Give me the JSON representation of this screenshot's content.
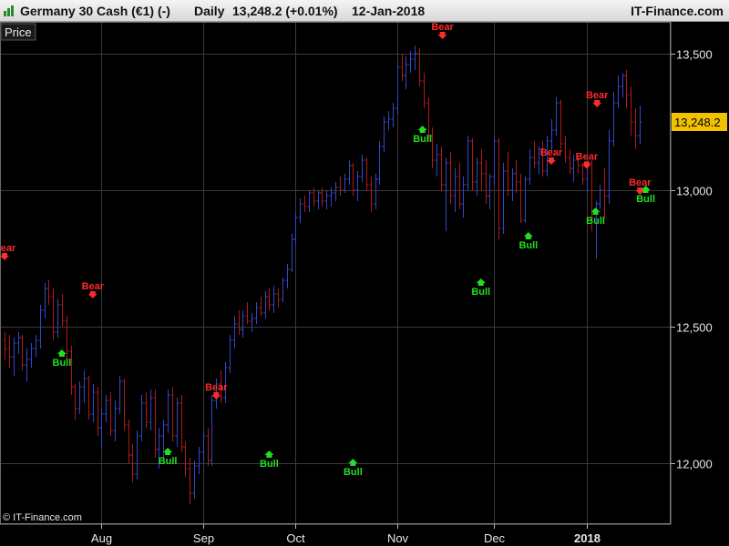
{
  "header": {
    "instrument": "Germany 30 Cash (€1) (-)",
    "period": "Daily",
    "price_change": "13,248.2 (+0.01%)",
    "date": "12-Jan-2018",
    "brand": "IT-Finance.com"
  },
  "panel_label": "Price",
  "copyright": "© IT-Finance.com",
  "last_price_label": "13,248.2",
  "colors": {
    "background": "#000000",
    "grid": "#3a3a3a",
    "up_bar": "#3048c8",
    "down_bar": "#b01818",
    "bull_signal": "#22dd22",
    "bear_signal": "#ff2a2a",
    "last_price_badge": "#f2c200"
  },
  "chart_data": {
    "type": "ohlc",
    "title": "Germany 30 Cash (€1) (-)",
    "ylim": [
      11850,
      13650
    ],
    "yticks": [
      {
        "value": 12000,
        "label": "12,000"
      },
      {
        "value": 12500,
        "label": "12,500"
      },
      {
        "value": 13000,
        "label": "13,000"
      },
      {
        "value": 13500,
        "label": "13,500"
      }
    ],
    "xticks": [
      {
        "index": 22,
        "label": "Aug"
      },
      {
        "index": 45,
        "label": "Sep"
      },
      {
        "index": 66,
        "label": "Oct"
      },
      {
        "index": 89,
        "label": "Nov"
      },
      {
        "index": 111,
        "label": "Dec"
      },
      {
        "index": 132,
        "label": "2018",
        "bold": true
      }
    ],
    "n_slots": 146,
    "bars": [
      [
        0,
        12450,
        12480,
        12380,
        12420
      ],
      [
        1,
        12420,
        12470,
        12350,
        12390
      ],
      [
        2,
        12390,
        12460,
        12320,
        12440
      ],
      [
        3,
        12440,
        12480,
        12400,
        12460
      ],
      [
        4,
        12460,
        12470,
        12340,
        12360
      ],
      [
        5,
        12360,
        12420,
        12300,
        12380
      ],
      [
        6,
        12380,
        12440,
        12350,
        12420
      ],
      [
        7,
        12420,
        12470,
        12390,
        12450
      ],
      [
        8,
        12450,
        12580,
        12420,
        12560
      ],
      [
        9,
        12560,
        12660,
        12530,
        12640
      ],
      [
        10,
        12640,
        12670,
        12580,
        12610
      ],
      [
        11,
        12610,
        12640,
        12450,
        12480
      ],
      [
        12,
        12480,
        12600,
        12460,
        12580
      ],
      [
        13,
        12580,
        12620,
        12500,
        12520
      ],
      [
        14,
        12520,
        12540,
        12380,
        12410
      ],
      [
        15,
        12410,
        12430,
        12250,
        12280
      ],
      [
        16,
        12280,
        12290,
        12160,
        12200
      ],
      [
        17,
        12200,
        12300,
        12180,
        12280
      ],
      [
        18,
        12280,
        12340,
        12220,
        12310
      ],
      [
        19,
        12310,
        12320,
        12160,
        12180
      ],
      [
        20,
        12180,
        12290,
        12150,
        12260
      ],
      [
        21,
        12260,
        12280,
        12100,
        12130
      ],
      [
        22,
        12130,
        12200,
        12050,
        12180
      ],
      [
        23,
        12180,
        12250,
        12150,
        12230
      ],
      [
        24,
        12230,
        12260,
        12100,
        12120
      ],
      [
        25,
        12120,
        12230,
        12080,
        12200
      ],
      [
        26,
        12200,
        12320,
        12180,
        12300
      ],
      [
        27,
        12300,
        12310,
        12120,
        12140
      ],
      [
        28,
        12140,
        12160,
        12000,
        12030
      ],
      [
        29,
        12030,
        12070,
        11930,
        11960
      ],
      [
        30,
        11960,
        12120,
        11940,
        12100
      ],
      [
        31,
        12100,
        12250,
        12080,
        12220
      ],
      [
        32,
        12220,
        12260,
        12130,
        12150
      ],
      [
        33,
        12150,
        12270,
        12120,
        12240
      ],
      [
        34,
        12240,
        12270,
        12020,
        12050
      ],
      [
        35,
        12050,
        12130,
        11980,
        12100
      ],
      [
        36,
        12100,
        12160,
        12020,
        12140
      ],
      [
        37,
        12140,
        12270,
        12110,
        12250
      ],
      [
        38,
        12250,
        12280,
        12080,
        12100
      ],
      [
        39,
        12100,
        12240,
        12060,
        12220
      ],
      [
        40,
        12220,
        12250,
        12040,
        12060
      ],
      [
        41,
        12060,
        12080,
        11950,
        11980
      ],
      [
        42,
        11980,
        12020,
        11850,
        11890
      ],
      [
        43,
        11890,
        12010,
        11870,
        11990
      ],
      [
        44,
        11990,
        12060,
        11960,
        12040
      ],
      [
        45,
        12040,
        12120,
        12000,
        12100
      ],
      [
        46,
        12100,
        12130,
        11990,
        12010
      ],
      [
        47,
        12010,
        12250,
        11990,
        12230
      ],
      [
        48,
        12230,
        12310,
        12200,
        12290
      ],
      [
        49,
        12290,
        12340,
        12220,
        12240
      ],
      [
        50,
        12240,
        12370,
        12220,
        12350
      ],
      [
        51,
        12350,
        12470,
        12330,
        12450
      ],
      [
        52,
        12450,
        12540,
        12420,
        12510
      ],
      [
        53,
        12510,
        12560,
        12470,
        12490
      ],
      [
        54,
        12490,
        12560,
        12460,
        12540
      ],
      [
        55,
        12540,
        12590,
        12510,
        12520
      ],
      [
        56,
        12520,
        12550,
        12480,
        12530
      ],
      [
        57,
        12530,
        12590,
        12510,
        12570
      ],
      [
        58,
        12570,
        12610,
        12540,
        12550
      ],
      [
        59,
        12550,
        12630,
        12530,
        12610
      ],
      [
        60,
        12610,
        12640,
        12560,
        12580
      ],
      [
        61,
        12580,
        12650,
        12550,
        12620
      ],
      [
        62,
        12620,
        12640,
        12570,
        12600
      ],
      [
        63,
        12600,
        12680,
        12590,
        12670
      ],
      [
        64,
        12670,
        12730,
        12640,
        12710
      ],
      [
        65,
        12710,
        12840,
        12700,
        12820
      ],
      [
        66,
        12820,
        12920,
        12800,
        12900
      ],
      [
        67,
        12900,
        12970,
        12880,
        12950
      ],
      [
        68,
        12950,
        12980,
        12920,
        12940
      ],
      [
        69,
        12940,
        13000,
        12920,
        12990
      ],
      [
        70,
        12990,
        13010,
        12940,
        12960
      ],
      [
        71,
        12960,
        13000,
        12930,
        12990
      ],
      [
        72,
        12990,
        13010,
        12940,
        12960
      ],
      [
        73,
        12960,
        13000,
        12930,
        12980
      ],
      [
        74,
        12980,
        13010,
        12940,
        12990
      ],
      [
        75,
        12990,
        13030,
        12960,
        13010
      ],
      [
        76,
        13010,
        13050,
        12980,
        13000
      ],
      [
        77,
        13000,
        13060,
        12990,
        13040
      ],
      [
        78,
        13040,
        13110,
        13020,
        13090
      ],
      [
        79,
        13090,
        13100,
        12980,
        13000
      ],
      [
        80,
        13000,
        13070,
        12960,
        13050
      ],
      [
        81,
        13050,
        13130,
        13030,
        13110
      ],
      [
        82,
        13110,
        13120,
        13000,
        13020
      ],
      [
        83,
        13020,
        13050,
        12920,
        12950
      ],
      [
        84,
        12950,
        13060,
        12930,
        13040
      ],
      [
        85,
        13040,
        13180,
        13020,
        13160
      ],
      [
        86,
        13160,
        13270,
        13140,
        13250
      ],
      [
        87,
        13250,
        13290,
        13220,
        13260
      ],
      [
        88,
        13260,
        13320,
        13230,
        13300
      ],
      [
        89,
        13300,
        13470,
        13280,
        13450
      ],
      [
        90,
        13450,
        13500,
        13400,
        13420
      ],
      [
        91,
        13420,
        13490,
        13370,
        13460
      ],
      [
        92,
        13460,
        13510,
        13430,
        13480
      ],
      [
        93,
        13480,
        13530,
        13440,
        13500
      ],
      [
        94,
        13500,
        13520,
        13380,
        13400
      ],
      [
        95,
        13400,
        13430,
        13300,
        13320
      ],
      [
        96,
        13320,
        13340,
        13180,
        13200
      ],
      [
        97,
        13200,
        13230,
        13080,
        13110
      ],
      [
        98,
        13110,
        13170,
        13050,
        13130
      ],
      [
        99,
        13130,
        13160,
        13000,
        13020
      ],
      [
        100,
        13020,
        13120,
        12850,
        13100
      ],
      [
        101,
        13100,
        13140,
        12950,
        12980
      ],
      [
        102,
        12980,
        13080,
        12920,
        13050
      ],
      [
        103,
        13050,
        13100,
        12930,
        12950
      ],
      [
        104,
        12950,
        13050,
        12900,
        13020
      ],
      [
        105,
        13020,
        13200,
        13000,
        13180
      ],
      [
        106,
        13180,
        13190,
        13000,
        13030
      ],
      [
        107,
        13030,
        13120,
        12980,
        13100
      ],
      [
        108,
        13100,
        13150,
        13000,
        13060
      ],
      [
        109,
        13060,
        13110,
        12950,
        12980
      ],
      [
        110,
        12980,
        13060,
        12930,
        13050
      ],
      [
        111,
        13050,
        13200,
        13020,
        13180
      ],
      [
        112,
        13180,
        13190,
        12820,
        12860
      ],
      [
        113,
        12860,
        13100,
        12840,
        13070
      ],
      [
        114,
        13070,
        13140,
        12980,
        13000
      ],
      [
        115,
        13000,
        13080,
        12960,
        13060
      ],
      [
        116,
        13060,
        13110,
        12990,
        13030
      ],
      [
        117,
        13030,
        13060,
        12880,
        12890
      ],
      [
        118,
        12890,
        13050,
        12880,
        13040
      ],
      [
        119,
        13040,
        13150,
        13020,
        13120
      ],
      [
        120,
        13120,
        13180,
        13080,
        13100
      ],
      [
        121,
        13100,
        13160,
        13060,
        13150
      ],
      [
        122,
        13150,
        13180,
        13050,
        13070
      ],
      [
        123,
        13070,
        13200,
        13050,
        13180
      ],
      [
        124,
        13180,
        13260,
        13140,
        13220
      ],
      [
        125,
        13220,
        13340,
        13200,
        13320
      ],
      [
        126,
        13320,
        13330,
        13150,
        13170
      ],
      [
        127,
        13170,
        13200,
        13100,
        13120
      ],
      [
        128,
        13120,
        13150,
        13060,
        13080
      ],
      [
        129,
        13080,
        13130,
        13030,
        13110
      ],
      [
        130,
        13110,
        13120,
        13060,
        13090
      ],
      [
        131,
        13090,
        13100,
        13020,
        13040
      ],
      [
        132,
        13040,
        13120,
        12990,
        13100
      ],
      [
        133,
        13100,
        13110,
        12850,
        12900
      ],
      [
        134,
        12900,
        12960,
        12750,
        12950
      ],
      [
        135,
        12950,
        13020,
        12930,
        13000
      ],
      [
        136,
        13000,
        13080,
        12900,
        12980
      ],
      [
        137,
        12980,
        13220,
        12950,
        13180
      ],
      [
        138,
        13180,
        13360,
        13160,
        13320
      ],
      [
        139,
        13320,
        13420,
        13300,
        13380
      ],
      [
        140,
        13380,
        13430,
        13340,
        13420
      ],
      [
        141,
        13420,
        13440,
        13300,
        13350
      ],
      [
        142,
        13350,
        13380,
        13200,
        13250
      ],
      [
        143,
        13250,
        13300,
        13150,
        13200
      ],
      [
        144,
        13200,
        13310,
        13170,
        13250
      ]
    ],
    "signals": [
      {
        "index": 0,
        "type": "bear",
        "label": "Bear",
        "value": 12760
      },
      {
        "index": 13,
        "type": "bull",
        "label": "Bull",
        "value": 12400
      },
      {
        "index": 20,
        "type": "bear",
        "label": "Bear",
        "value": 12620
      },
      {
        "index": 37,
        "type": "bull",
        "label": "Bull",
        "value": 12040
      },
      {
        "index": 48,
        "type": "bear",
        "label": "Bear",
        "value": 12250
      },
      {
        "index": 60,
        "type": "bull",
        "label": "Bull",
        "value": 12030
      },
      {
        "index": 79,
        "type": "bull",
        "label": "Bull",
        "value": 12000
      },
      {
        "index": 108,
        "type": "bull",
        "label": "Bull",
        "value": 12660
      },
      {
        "index": 132,
        "type": "bear",
        "label": "Bear",
        "value": 13095
      },
      {
        "index": 134,
        "type": "bull",
        "label": "Bull",
        "value": 12920
      },
      {
        "index": 153,
        "type": "bear",
        "label": "Bear",
        "value": 13570
      },
      {
        "index": 146,
        "type": "bull",
        "label": "Bull",
        "value": 13220
      },
      {
        "index": 183,
        "type": "bull",
        "label": "Bull",
        "value": 12830
      },
      {
        "index": 191,
        "type": "bear",
        "label": "Bear",
        "value": 13110
      },
      {
        "index": 207,
        "type": "bear",
        "label": "Bear",
        "value": 13320
      },
      {
        "index": 222,
        "type": "bear",
        "label": "Bear",
        "value": 13000
      },
      {
        "index": 224,
        "type": "bull",
        "label": "Bull",
        "value": 13000
      }
    ]
  }
}
